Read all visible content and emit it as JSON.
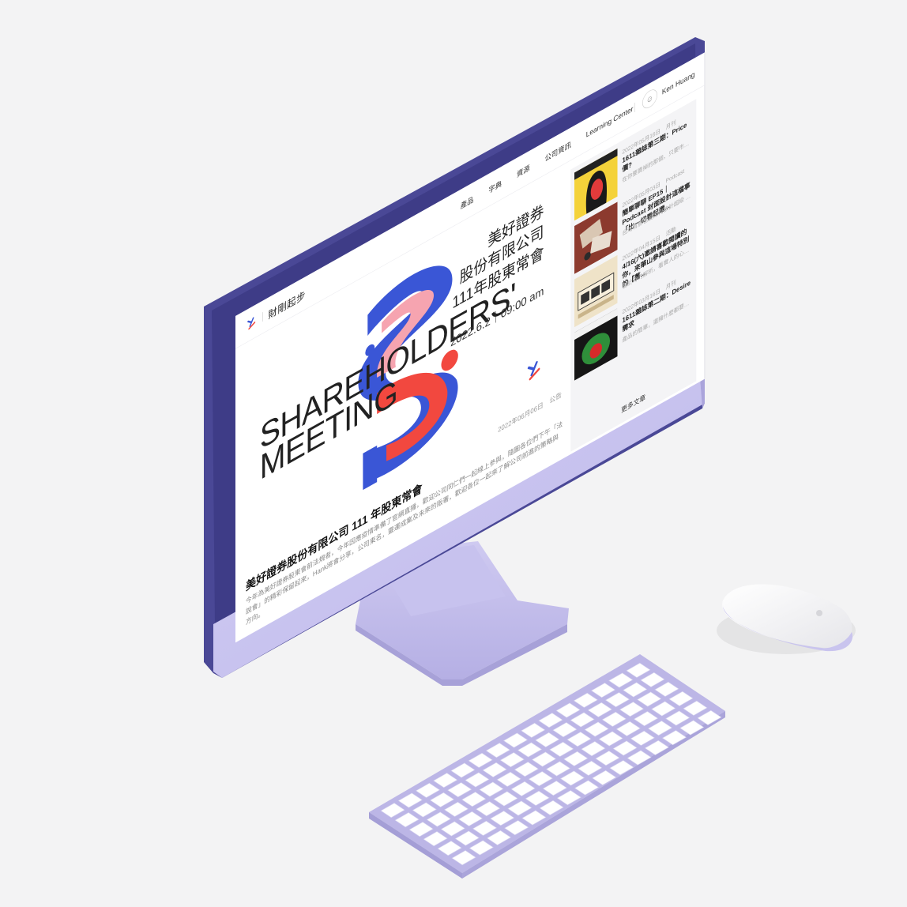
{
  "nav": {
    "brand": "財剛起步",
    "menu": [
      "產品",
      "字典",
      "資源",
      "公司資訊",
      "Learning Center"
    ],
    "user_name": "Ken Huang"
  },
  "hero": {
    "title_en_1": "SHAREHOLDERS'",
    "title_en_2": "MEETING",
    "title_zh_1": "美好證券",
    "title_zh_2": "股份有限公司",
    "title_zh_3": "111年股東常會",
    "date": "2022.6.2｜09:00 am"
  },
  "article": {
    "meta": "2022年06月06日　公告",
    "title": "美好證券股份有限公司 111 年股東常會",
    "body": "今年為美好證券股東會前法規者，今年因應疫情準備了官網直播，歡迎公司同仁們一起線上參與，隨圖各位們下午「法說會」的精彩保留起來，Hank將會分享，公司東名，靈運成業及未來的版署，歡迎各位一起來了解公司前進的策略與方向。"
  },
  "sidebar": {
    "cards": [
      {
        "meta": "2022年05月16日　月刊",
        "title": "1611雜誌第三期：Price 價?",
        "excerpt": "在你要賣掉的那個，只要市場中大..."
      },
      {
        "meta": "2022年05月03日　Podcast",
        "title": "簡單聊聊 EP15｜Podcast 封面設計這檔事「比一切看起還...",
        "excerpt": "台灣有那也要如何放計超級 Nomo：那..."
      },
      {
        "meta": "2022年04月15日　活動",
        "title": "4/16(六)邀請喜歡閱讀的你，來華山參與這場特別的【舊...",
        "excerpt": "書於時的解析，看實人的心意思..."
      },
      {
        "meta": "2022年03月16日　月刊",
        "title": "1611雜誌第二期：Desire 需求",
        "excerpt": "產品的簡單，還擁什麼都要了..."
      }
    ],
    "more_label": "更多文章"
  },
  "colors": {
    "screen_bezel": "#4a4896",
    "monitor_body": "#c9c4ee",
    "stand": "#bdb8e8",
    "keyboard": "#c4bfea",
    "art_red": "#f2483f",
    "art_blue": "#3a56d6",
    "art_pink": "#f6a4b0"
  }
}
